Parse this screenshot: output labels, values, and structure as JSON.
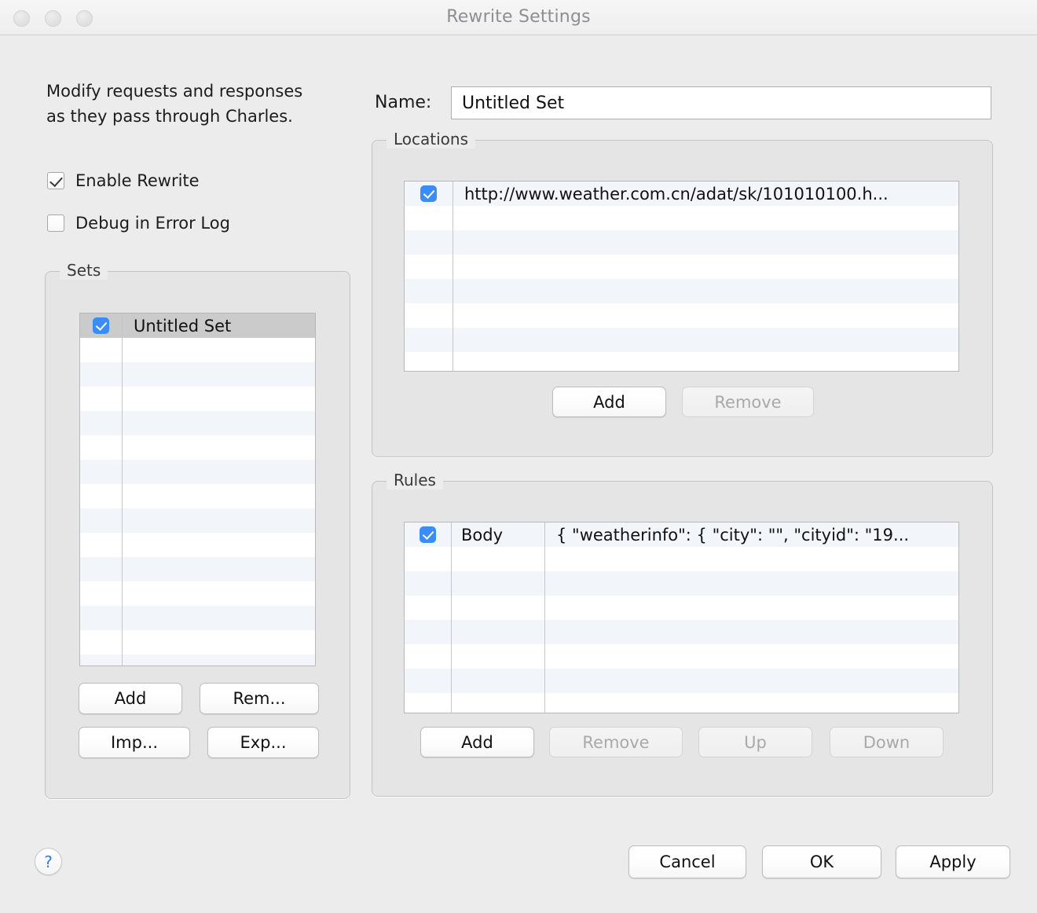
{
  "window": {
    "title": "Rewrite Settings",
    "traffic_lights": [
      "close-button",
      "minimize-button",
      "zoom-button"
    ]
  },
  "sidebar": {
    "description": "Modify requests and responses as they pass through Charles.",
    "checkboxes": [
      {
        "label": "Enable Rewrite",
        "checked": true
      },
      {
        "label": "Debug in Error Log",
        "checked": false
      }
    ],
    "sets_group": {
      "label": "Sets",
      "rows": [
        {
          "label": "Untitled Set",
          "checked": true,
          "selected": true
        }
      ],
      "buttons": [
        {
          "label": "Add",
          "enabled": true
        },
        {
          "label": "Rem...",
          "enabled": true
        },
        {
          "label": "Imp...",
          "enabled": true
        },
        {
          "label": "Exp...",
          "enabled": true
        }
      ]
    }
  },
  "main": {
    "name_label": "Name:",
    "name_value": "Untitled Set",
    "name_placeholder": "",
    "locations_group": {
      "label": "Locations",
      "rows": [
        {
          "value": "http://www.weather.com.cn/adat/sk/101010100.h...",
          "checked": true
        }
      ],
      "buttons": [
        {
          "label": "Add",
          "enabled": true
        },
        {
          "label": "Remove",
          "enabled": false
        }
      ]
    },
    "rules_group": {
      "label": "Rules",
      "rows": [
        {
          "type": "Body",
          "value": "{  \"weatherinfo\": {   \"city\": \"\",   \"cityid\": \"19...",
          "checked": true
        }
      ],
      "buttons": [
        {
          "label": "Add",
          "enabled": true
        },
        {
          "label": "Remove",
          "enabled": false
        },
        {
          "label": "Up",
          "enabled": false
        },
        {
          "label": "Down",
          "enabled": false
        }
      ]
    }
  },
  "footer": {
    "help_label": "?",
    "buttons": [
      {
        "label": "Cancel"
      },
      {
        "label": "OK"
      },
      {
        "label": "Apply"
      }
    ]
  },
  "colors": {
    "window_background": "#ececec",
    "group_background": "#e5e5e5",
    "accent_checkbox": "#3b8cf6",
    "row_stripe": "#f2f6fb",
    "row_selected": "#cbcbcb",
    "title_text": "#8e8e93",
    "help_icon": "#2e7bea"
  }
}
